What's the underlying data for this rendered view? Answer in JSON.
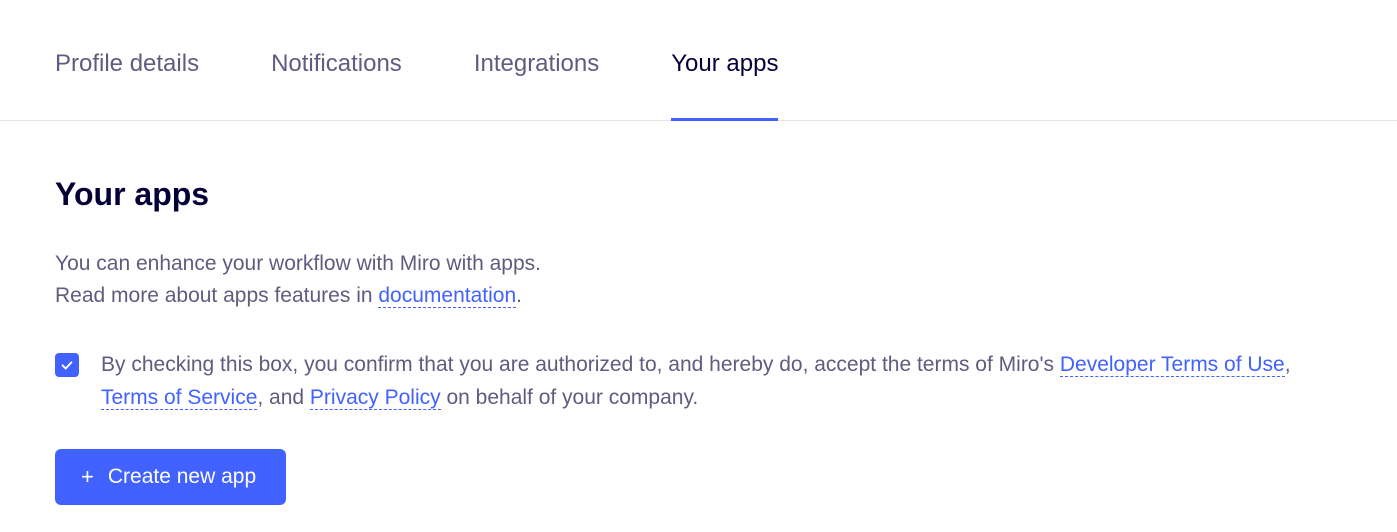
{
  "tabs": [
    {
      "label": "Profile details",
      "active": false
    },
    {
      "label": "Notifications",
      "active": false
    },
    {
      "label": "Integrations",
      "active": false
    },
    {
      "label": "Your apps",
      "active": true
    }
  ],
  "page": {
    "title": "Your apps",
    "description_line1": "You can enhance your workflow with Miro with apps.",
    "description_line2_prefix": "Read more about apps features in ",
    "description_link": "documentation",
    "description_line2_suffix": "."
  },
  "terms": {
    "checked": true,
    "text_prefix": "By checking this box, you confirm that you are authorized to, and hereby do, accept the terms of Miro's ",
    "link1": "Developer Terms of Use",
    "sep1": ", ",
    "link2": "Terms of Service",
    "sep2": ", and ",
    "link3": "Privacy Policy",
    "text_suffix": " on behalf of your company."
  },
  "button": {
    "label": "Create new app"
  }
}
